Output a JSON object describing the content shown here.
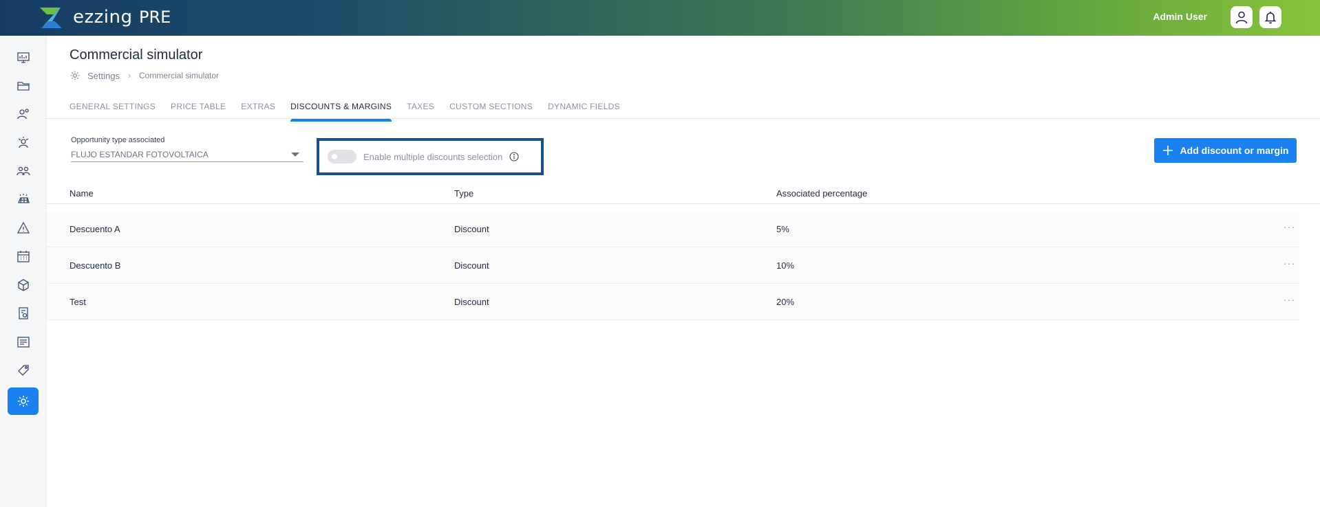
{
  "header": {
    "brand": "ezzing",
    "env": "PRE",
    "user_name": "Admin User",
    "accent_gradient": [
      "#153d63",
      "#86c43a"
    ]
  },
  "sidebar": {
    "items": [
      {
        "icon": "dashboard-icon"
      },
      {
        "icon": "folder-icon"
      },
      {
        "icon": "leads-icon"
      },
      {
        "icon": "opportunities-icon"
      },
      {
        "icon": "clients-icon"
      },
      {
        "icon": "solar-panel-icon"
      },
      {
        "icon": "warning-icon"
      },
      {
        "icon": "calendar-icon"
      },
      {
        "icon": "package-icon"
      },
      {
        "icon": "billing-icon"
      },
      {
        "icon": "reports-icon"
      },
      {
        "icon": "tag-icon"
      },
      {
        "icon": "settings-icon",
        "active": true
      }
    ],
    "active_color": "#1a82f0"
  },
  "page": {
    "title": "Commercial simulator",
    "breadcrumb": {
      "root": "Settings",
      "separator": "›",
      "current": "Commercial simulator"
    }
  },
  "tabs": [
    {
      "label": "GENERAL SETTINGS"
    },
    {
      "label": "PRICE TABLE"
    },
    {
      "label": "EXTRAS"
    },
    {
      "label": "DISCOUNTS & MARGINS",
      "active": true
    },
    {
      "label": "TAXES"
    },
    {
      "label": "CUSTOM SECTIONS"
    },
    {
      "label": "DYNAMIC FIELDS"
    }
  ],
  "filters": {
    "opportunity_label": "Opportunity type associated",
    "opportunity_value": "FLUJO ESTANDAR FOTOVOLTAICA",
    "toggle_label": "Enable multiple discounts selection",
    "toggle_on": false,
    "add_button": "Add discount or margin"
  },
  "table": {
    "columns": [
      "Name",
      "Type",
      "Associated percentage"
    ],
    "rows": [
      {
        "name": "Descuento A",
        "type": "Discount",
        "percentage": "5%",
        "actions": "···"
      },
      {
        "name": "Descuento B",
        "type": "Discount",
        "percentage": "10%",
        "actions": "···"
      },
      {
        "name": "Test",
        "type": "Discount",
        "percentage": "20%",
        "actions": "···"
      }
    ]
  }
}
